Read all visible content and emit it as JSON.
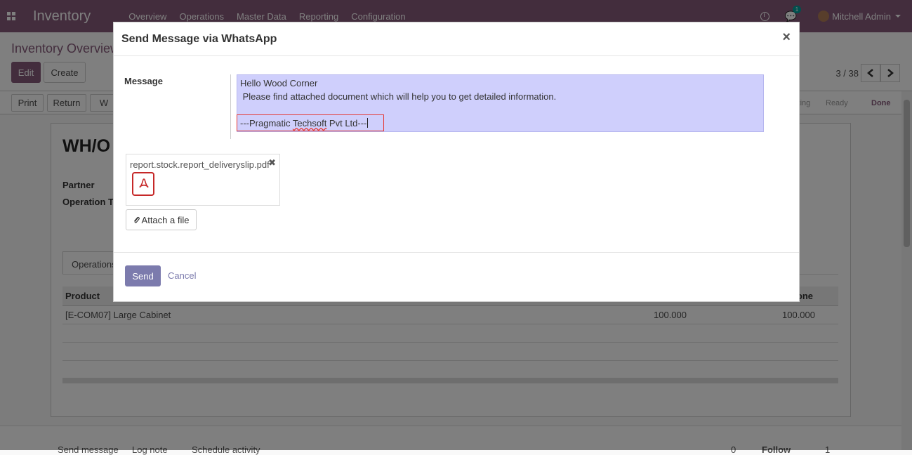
{
  "navbar": {
    "brand": "Inventory",
    "menu": [
      "Overview",
      "Operations",
      "Master Data",
      "Reporting",
      "Configuration"
    ],
    "chat_count": "1",
    "user_name": "Mitchell Admin"
  },
  "control": {
    "breadcrumb": "Inventory Overview",
    "edit_label": "Edit",
    "create_label": "Create",
    "pager": "3 / 38"
  },
  "statusrow": {
    "print_label": "Print",
    "return_label": "Return",
    "whatsapp_label": "W",
    "stages": [
      "Waiting",
      "Ready",
      "Done"
    ]
  },
  "sheet": {
    "title": "WH/O",
    "partner_label": "Partner",
    "operation_type_label": "Operation T",
    "tab_label": "Operations",
    "columns": {
      "product": "Product",
      "done": "one"
    },
    "rows": [
      {
        "product": "[E-COM07] Large Cabinet",
        "demand": "100.000",
        "done": "100.000"
      }
    ]
  },
  "chatter": {
    "send_message": "Send message",
    "log_note": "Log note",
    "schedule_activity": "Schedule activity",
    "attachments_count": "0",
    "follow_label": "Follow",
    "followers_count": "1"
  },
  "modal": {
    "title": "Send Message via WhatsApp",
    "close_symbol": "×",
    "message_label": "Message",
    "message_lines": [
      "Hello Wood Corner",
      " Please find attached document which will help you to get detailed information."
    ],
    "signature_prefix": "---Pragmatic ",
    "signature_word": "Techsoft",
    "signature_suffix": " Pvt Ltd---",
    "attachment_name": "report.stock.report_deliveryslip.pdf",
    "attach_file_label": "Attach a file",
    "send_label": "Send",
    "cancel_label": "Cancel"
  },
  "colors": {
    "brand": "#875a7b",
    "message_bg": "#cfcffc",
    "send_button": "#7c7bad",
    "highlight_border": "#e53935"
  }
}
